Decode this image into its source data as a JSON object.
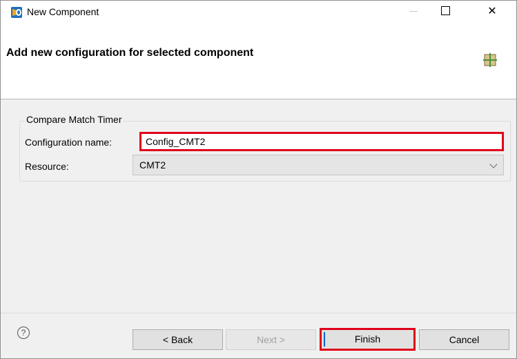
{
  "window": {
    "title": "New Component"
  },
  "banner": {
    "title": "Add new configuration for selected component"
  },
  "group": {
    "title": "Compare Match Timer",
    "config_label": "Configuration name:",
    "config_value": "Config_CMT2",
    "resource_label": "Resource:",
    "resource_value": "CMT2"
  },
  "footer": {
    "help_symbol": "?",
    "back_label": "< Back",
    "next_label": "Next >",
    "finish_label": "Finish",
    "cancel_label": "Cancel"
  },
  "colors": {
    "highlight": "#e0001a",
    "background": "#f0f0f0"
  }
}
